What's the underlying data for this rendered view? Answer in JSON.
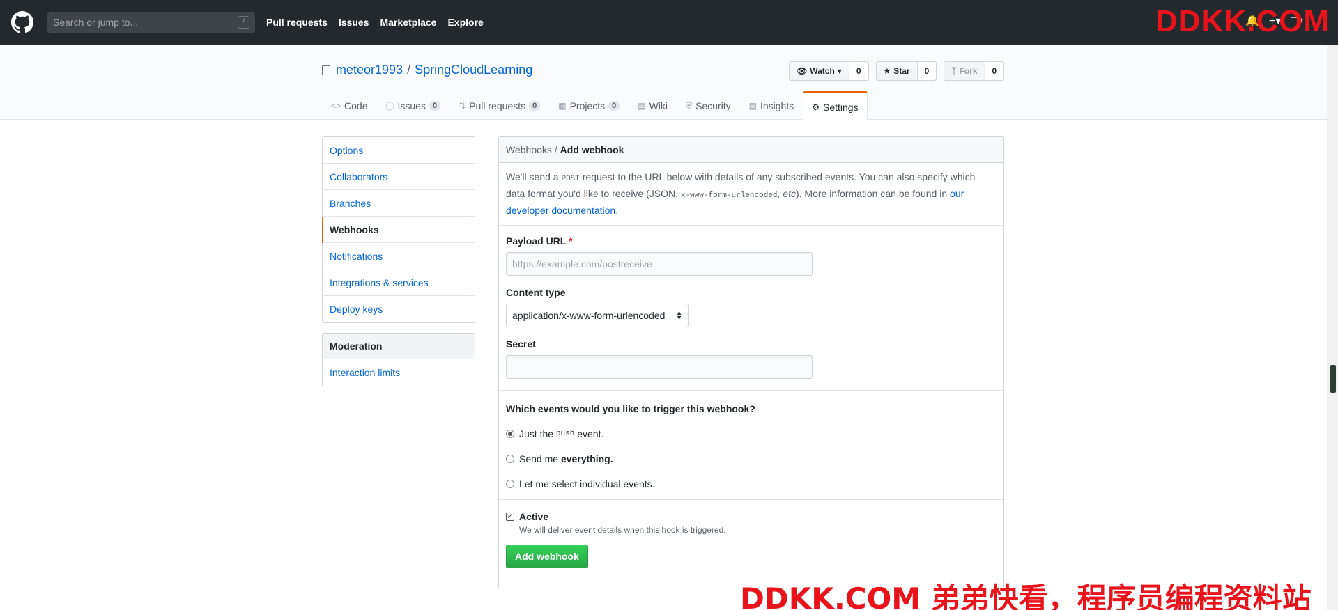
{
  "header": {
    "search_placeholder": "Search or jump to...",
    "slash_key": "/",
    "nav": [
      "Pull requests",
      "Issues",
      "Marketplace",
      "Explore"
    ]
  },
  "repo": {
    "owner": "meteor1993",
    "separator": "/",
    "name": "SpringCloudLearning",
    "watch": {
      "label": "Watch",
      "count": "0"
    },
    "star": {
      "label": "Star",
      "count": "0"
    },
    "fork": {
      "label": "Fork",
      "count": "0"
    },
    "tabs": [
      {
        "label": "Code",
        "icon": "code-icon"
      },
      {
        "label": "Issues",
        "icon": "issue-icon",
        "count": "0"
      },
      {
        "label": "Pull requests",
        "icon": "pull-request-icon",
        "count": "0"
      },
      {
        "label": "Projects",
        "icon": "project-icon",
        "count": "0"
      },
      {
        "label": "Wiki",
        "icon": "book-icon"
      },
      {
        "label": "Security",
        "icon": "shield-icon"
      },
      {
        "label": "Insights",
        "icon": "graph-icon"
      },
      {
        "label": "Settings",
        "icon": "gear-icon",
        "selected": true
      }
    ]
  },
  "sidebar": {
    "items": [
      "Options",
      "Collaborators",
      "Branches",
      "Webhooks",
      "Notifications",
      "Integrations & services",
      "Deploy keys"
    ],
    "selected": "Webhooks",
    "moderation": {
      "heading": "Moderation",
      "items": [
        "Interaction limits"
      ]
    }
  },
  "form": {
    "breadcrumb": "Webhooks /",
    "title": "Add webhook",
    "intro": {
      "part1": "We'll send a ",
      "code1": "POST",
      "part2": " request to the URL below with details of any subscribed events. You can also specify which data format you'd like to receive (JSON, ",
      "code2": "x-www-form-urlencoded",
      "part3": ", ",
      "etc": "etc",
      "part4": "). More information can be found in ",
      "link": "our developer documentation",
      "part5": "."
    },
    "payload_label": "Payload URL",
    "required_mark": "*",
    "payload_placeholder": "https://example.com/postreceive",
    "content_type_label": "Content type",
    "content_type_value": "application/x-www-form-urlencoded",
    "secret_label": "Secret",
    "events_question": "Which events would you like to trigger this webhook?",
    "event_options": {
      "just_push_pre": "Just the ",
      "just_push_code": "push",
      "just_push_post": " event.",
      "everything_pre": "Send me ",
      "everything_bold": "everything.",
      "individual": "Let me select individual events."
    },
    "active_label": "Active",
    "active_note": "We will deliver event details when this hook is triggered.",
    "submit_label": "Add webhook"
  },
  "watermarks": {
    "top": "DDKK.COM",
    "bottom": "DDKK.COM 弟弟快看，程序员编程资料站"
  },
  "colors": {
    "accent": "#e36209",
    "link": "#0366d6",
    "primary_button": "#28a745",
    "watermark": "#e8131b"
  }
}
